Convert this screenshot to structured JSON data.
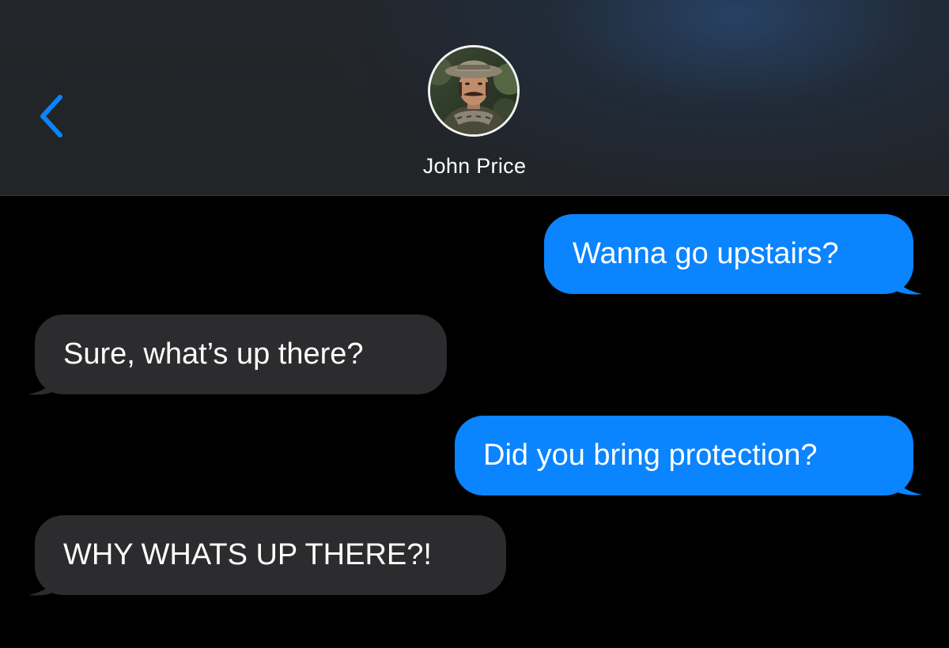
{
  "header": {
    "contact_name": "John Price",
    "back_icon": "chevron-left-icon",
    "accent_color": "#0a84ff"
  },
  "messages": [
    {
      "direction": "sent",
      "text": "Wanna go upstairs?"
    },
    {
      "direction": "received",
      "text": "Sure, what’s up there?"
    },
    {
      "direction": "sent",
      "text": "Did you bring protection?"
    },
    {
      "direction": "received",
      "text": "WHY WHATS UP THERE?!"
    }
  ],
  "colors": {
    "sent_bubble": "#0a84ff",
    "received_bubble": "#2c2c2e",
    "background": "#000000",
    "header_background": "#232629"
  }
}
